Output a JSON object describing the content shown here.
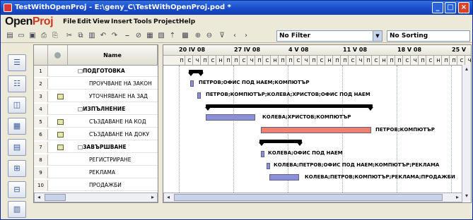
{
  "window": {
    "title": "TestWithOpenProj - E:\\geny_C\\TestWithOpenProj.pod *"
  },
  "logo": {
    "part1": "Open",
    "part2": "Proj"
  },
  "menu": [
    "File",
    "Edit",
    "View",
    "Insert",
    "Tools",
    "Project",
    "Help"
  ],
  "toolbar": {
    "filter": "No Filter",
    "sorting": "No Sorting"
  },
  "grid": {
    "col_name": "Name"
  },
  "tasks": [
    {
      "id": "1",
      "name": "□ПОДГОТОВКА",
      "bold": true,
      "indent": 0
    },
    {
      "id": "2",
      "name": "ПРОУЧВАНЕ НА ЗАКОН",
      "bold": false,
      "indent": 1
    },
    {
      "id": "3",
      "name": "УТОЧНЯВАНЕ НА ЗАД",
      "bold": false,
      "indent": 1,
      "note": true
    },
    {
      "id": "4",
      "name": "□ИЗПЪЛНЕНИЕ",
      "bold": true,
      "indent": 0
    },
    {
      "id": "5",
      "name": "СЪЗДАВАНЕ НА КОД",
      "bold": false,
      "indent": 1,
      "note": true
    },
    {
      "id": "6",
      "name": "СЪЗДАВАНЕ НА ДОКУ",
      "bold": false,
      "indent": 1,
      "note": true
    },
    {
      "id": "7",
      "name": "□ЗАВЪРШВАНЕ",
      "bold": true,
      "indent": 0,
      "note": true
    },
    {
      "id": "8",
      "name": "РЕГИСТРИРАНЕ",
      "bold": false,
      "indent": 1
    },
    {
      "id": "9",
      "name": "РЕКЛАМА",
      "bold": false,
      "indent": 1
    },
    {
      "id": "10",
      "name": "ПРОДАЖБИ",
      "bold": false,
      "indent": 1
    }
  ],
  "gantt": {
    "weeks": [
      "20 IV 08",
      "27 IV 08",
      "4 V 08",
      "11 V 08",
      "18 V 08",
      "25 V"
    ],
    "days": [
      "П",
      "С",
      "Ч",
      "П",
      "С",
      "Н",
      "П"
    ],
    "labels": [
      "ПЕТРОВ;ОФИС ПОД НАЕМ;КОМПЮТЪР",
      "ПЕТРОВ;КОМПЮТЪР;КОЛЕВА;ХРИСТОВ;ОФИС ПОД НАЕМ",
      "КОЛЕВА;ХРИСТОВ;КОМПЮТЪР",
      "ПЕТРОВ;КОМПЮТЪР",
      "КОЛЕВА;ОФИС ПОД НАЕМ",
      "КОЛЕВА;ПЕТРОВ;ОФИС ПОД НАЕМ;КОМПЮТЪР;РЕКЛАМА",
      "КОЛЕВА;ПЕТРОВ;КОМПЮТЪР;РЕКЛАМА;ПРОДАЖБИ"
    ]
  },
  "colors": {
    "bar_blue": "#8b8fd8",
    "bar_red": "#f08070",
    "titlebar": "#1848c8"
  }
}
